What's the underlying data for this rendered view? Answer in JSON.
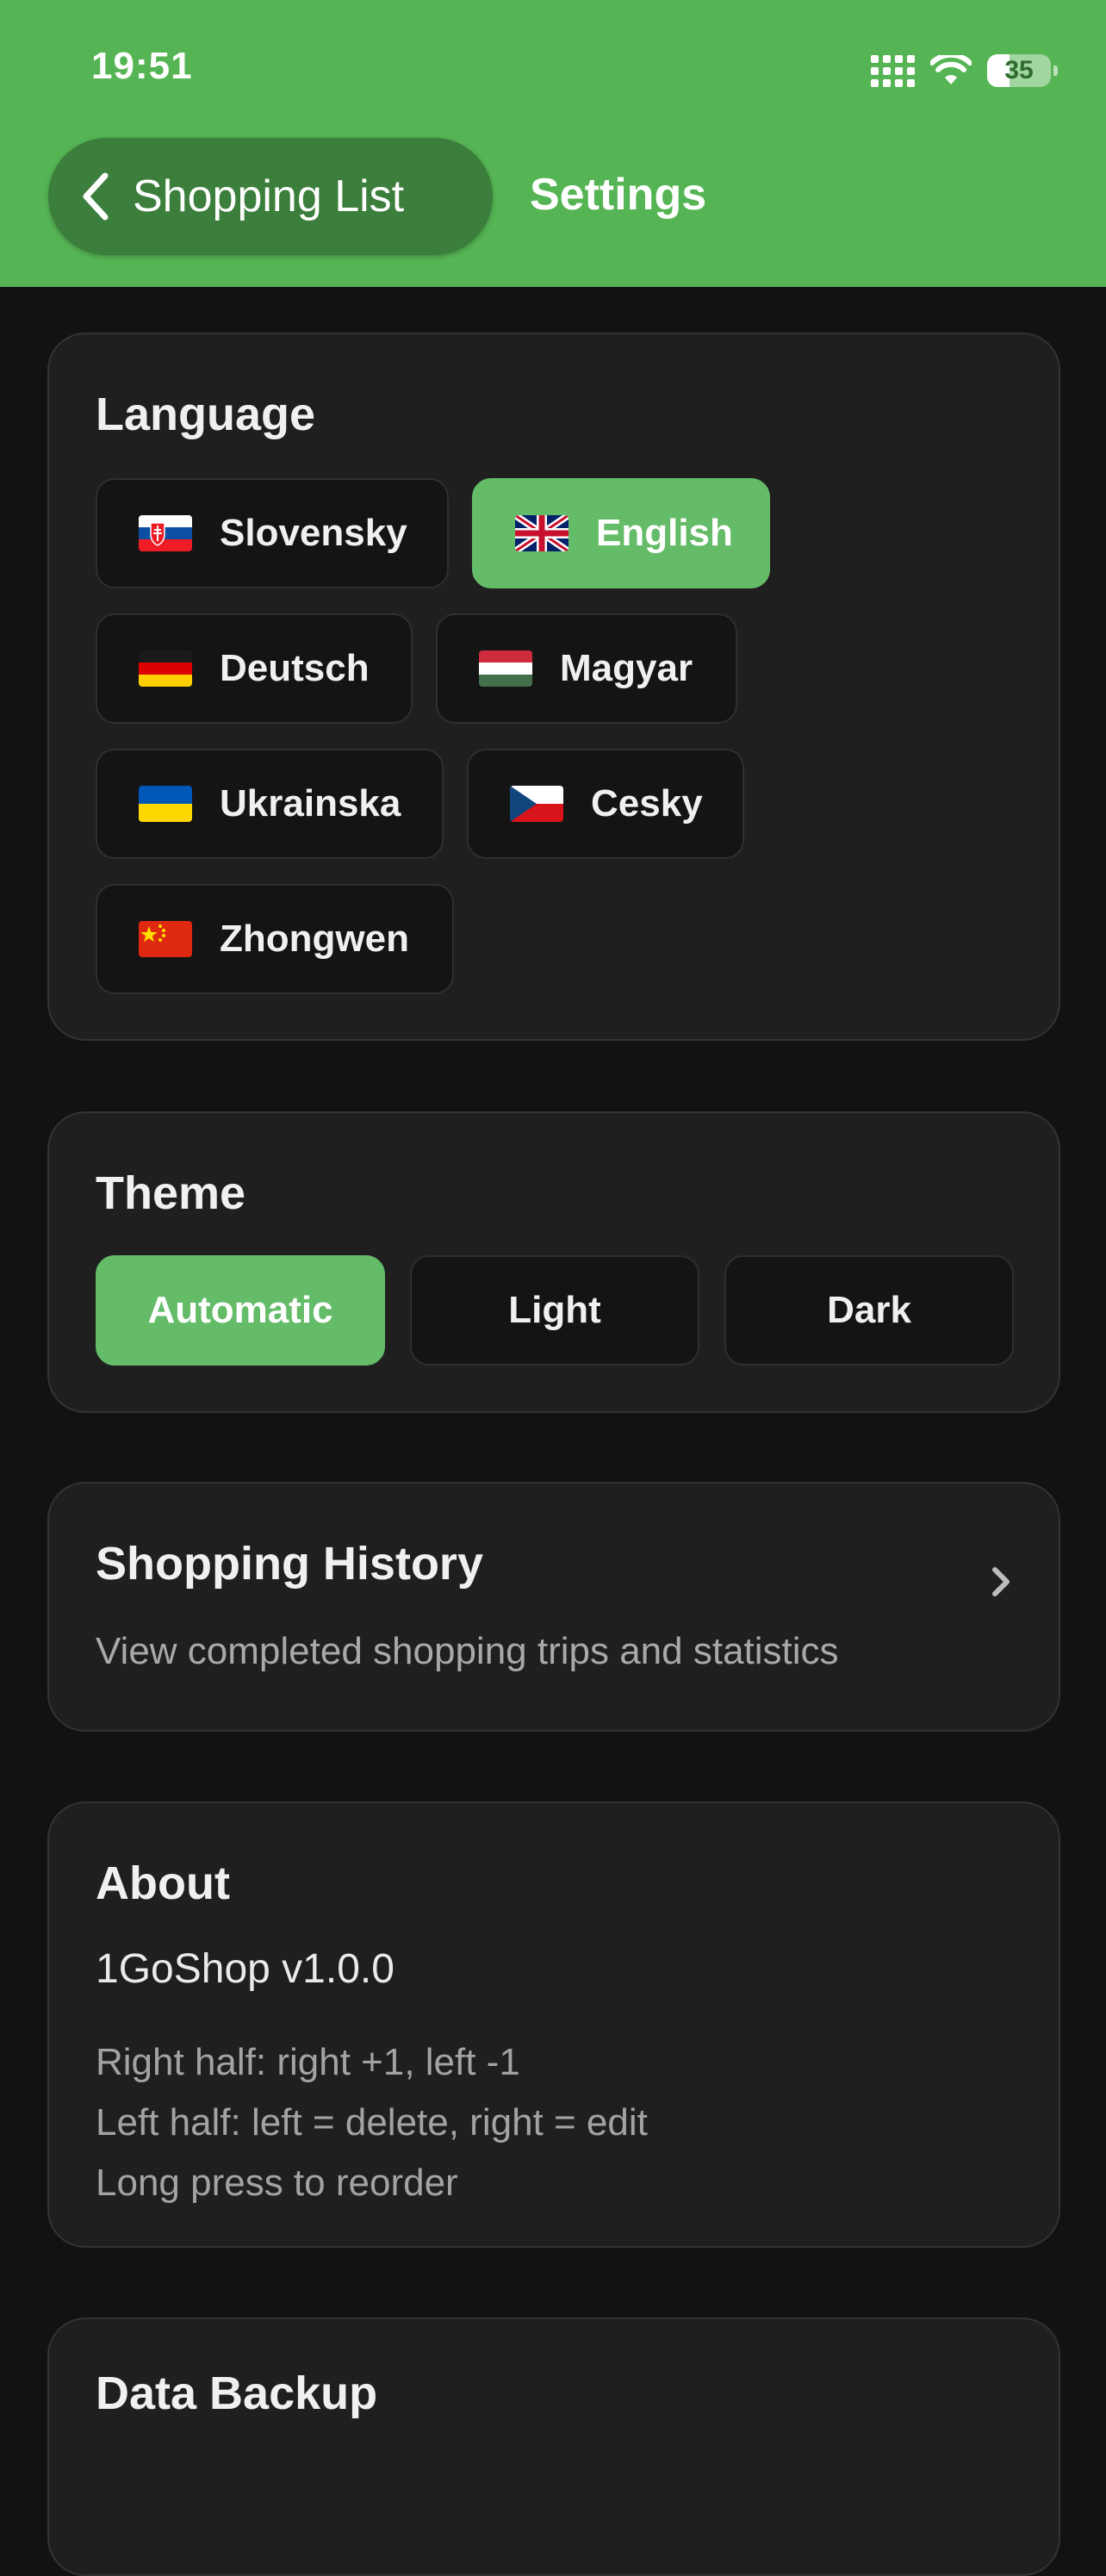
{
  "status_bar": {
    "time": "19:51",
    "battery": "35",
    "battery_level": 0.35
  },
  "header": {
    "back_label": "Shopping List",
    "title": "Settings"
  },
  "language": {
    "title": "Language",
    "options": [
      {
        "label": "Slovensky",
        "flag": "slovakia-flag-icon",
        "selected": false
      },
      {
        "label": "English",
        "flag": "uk-flag-icon",
        "selected": true
      },
      {
        "label": "Deutsch",
        "flag": "germany-flag-icon",
        "selected": false
      },
      {
        "label": "Magyar",
        "flag": "hungary-flag-icon",
        "selected": false
      },
      {
        "label": "Ukrainska",
        "flag": "ukraine-flag-icon",
        "selected": false
      },
      {
        "label": "Cesky",
        "flag": "czech-flag-icon",
        "selected": false
      },
      {
        "label": "Zhongwen",
        "flag": "china-flag-icon",
        "selected": false
      }
    ]
  },
  "theme": {
    "title": "Theme",
    "options": [
      {
        "label": "Automatic",
        "selected": true
      },
      {
        "label": "Light",
        "selected": false
      },
      {
        "label": "Dark",
        "selected": false
      }
    ]
  },
  "history": {
    "title": "Shopping History",
    "description": "View completed shopping trips and statistics"
  },
  "about": {
    "title": "About",
    "version": "1GoShop v1.0.0",
    "help": [
      "Right half: right +1, left -1",
      "Left half: left = delete, right = edit",
      "Long press to reorder"
    ]
  },
  "backup": {
    "title": "Data Backup"
  },
  "colors": {
    "header": "#55b554",
    "accent": "#64bc69",
    "card": "#1f1f1f",
    "background": "#121212"
  }
}
